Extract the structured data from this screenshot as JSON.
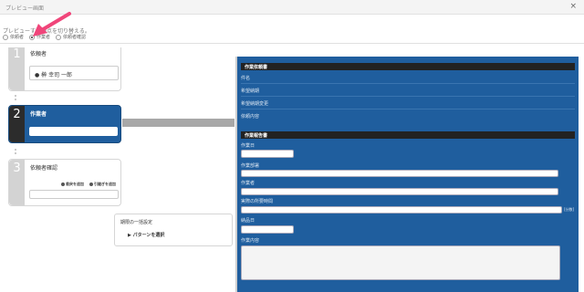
{
  "window": {
    "title": "プレビュー画面",
    "close_label": "×"
  },
  "preview_prompt": "プレビューする視点を切り替える。",
  "view_options": [
    {
      "label": "依頼者",
      "checked": false
    },
    {
      "label": "作業者",
      "checked": true
    },
    {
      "label": "依頼者確認",
      "checked": false
    }
  ],
  "steps": [
    {
      "number": "1",
      "label": "依頼者",
      "person": "榊 幸司 一郎"
    },
    {
      "number": "2",
      "label": "作業者"
    },
    {
      "number": "3",
      "label": "依頼者確認",
      "buttons": [
        "差戻を追加",
        "引継ぎを追加"
      ]
    }
  ],
  "bulk_settings": {
    "title": "期限の一括設定",
    "pattern_label": "▶ パターンを選択"
  },
  "form": {
    "request_section": "作業依頼書",
    "request_fields": [
      "件名",
      "希望納期",
      "希望納期変更",
      "依頼内容"
    ],
    "report_section": "作業報告書",
    "report_fields": [
      "作業日",
      "作業部署",
      "作業者",
      "実際の所要時間",
      "納品日",
      "作業内容"
    ],
    "time_unit": "[分数]"
  },
  "colors": {
    "accent": "#1f5e9e",
    "arrow": "#f0457a"
  }
}
